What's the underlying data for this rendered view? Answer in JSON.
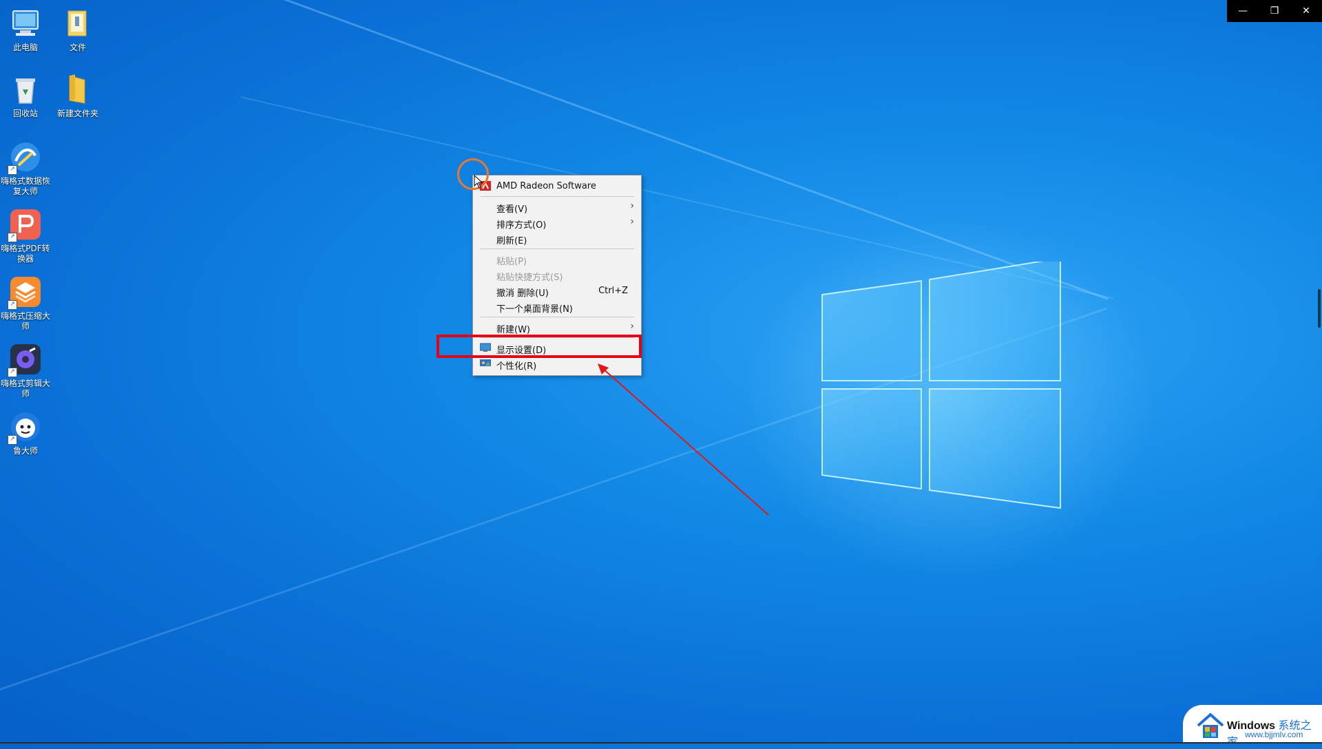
{
  "window_controls": {
    "minimize": "—",
    "restore": "❐",
    "close": "✕"
  },
  "desktop_icons": [
    {
      "label": "此电脑",
      "icon": "computer-icon"
    },
    {
      "label": "文件",
      "icon": "folder-icon"
    },
    {
      "label": "回收站",
      "icon": "recycle-bin-icon"
    },
    {
      "label": "新建文件夹",
      "icon": "folder-icon"
    },
    {
      "label": "嗨格式数据恢复大师",
      "icon": "data-recovery-app-icon"
    },
    {
      "label": "嗨格式PDF转换器",
      "icon": "pdf-converter-app-icon"
    },
    {
      "label": "嗨格式压缩大师",
      "icon": "compress-app-icon"
    },
    {
      "label": "嗨格式剪辑大师",
      "icon": "video-editor-app-icon"
    },
    {
      "label": "鲁大师",
      "icon": "ludashi-app-icon"
    }
  ],
  "context_menu": {
    "items": [
      {
        "label": "AMD Radeon Software",
        "icon": "amd-radeon-icon"
      },
      {
        "label": "查看(V)",
        "submenu": true
      },
      {
        "label": "排序方式(O)",
        "submenu": true
      },
      {
        "label": "刷新(E)"
      },
      {
        "label": "粘贴(P)",
        "disabled": true
      },
      {
        "label": "粘贴快捷方式(S)",
        "disabled": true
      },
      {
        "label": "撤消 删除(U)",
        "shortcut": "Ctrl+Z"
      },
      {
        "label": "下一个桌面背景(N)"
      },
      {
        "label": "新建(W)",
        "submenu": true
      },
      {
        "label": "显示设置(D)",
        "icon": "display-settings-icon",
        "highlighted": true
      },
      {
        "label": "个性化(R)",
        "icon": "personalize-icon"
      }
    ],
    "arrow_glyph": "›"
  },
  "watermark": {
    "brand": "Windows",
    "suffix": "系统之家",
    "url": "www.bjjmlv.com"
  },
  "colors": {
    "highlight": "#e60012",
    "cursor_circle": "#e8772e",
    "arrow": "#e01818"
  }
}
